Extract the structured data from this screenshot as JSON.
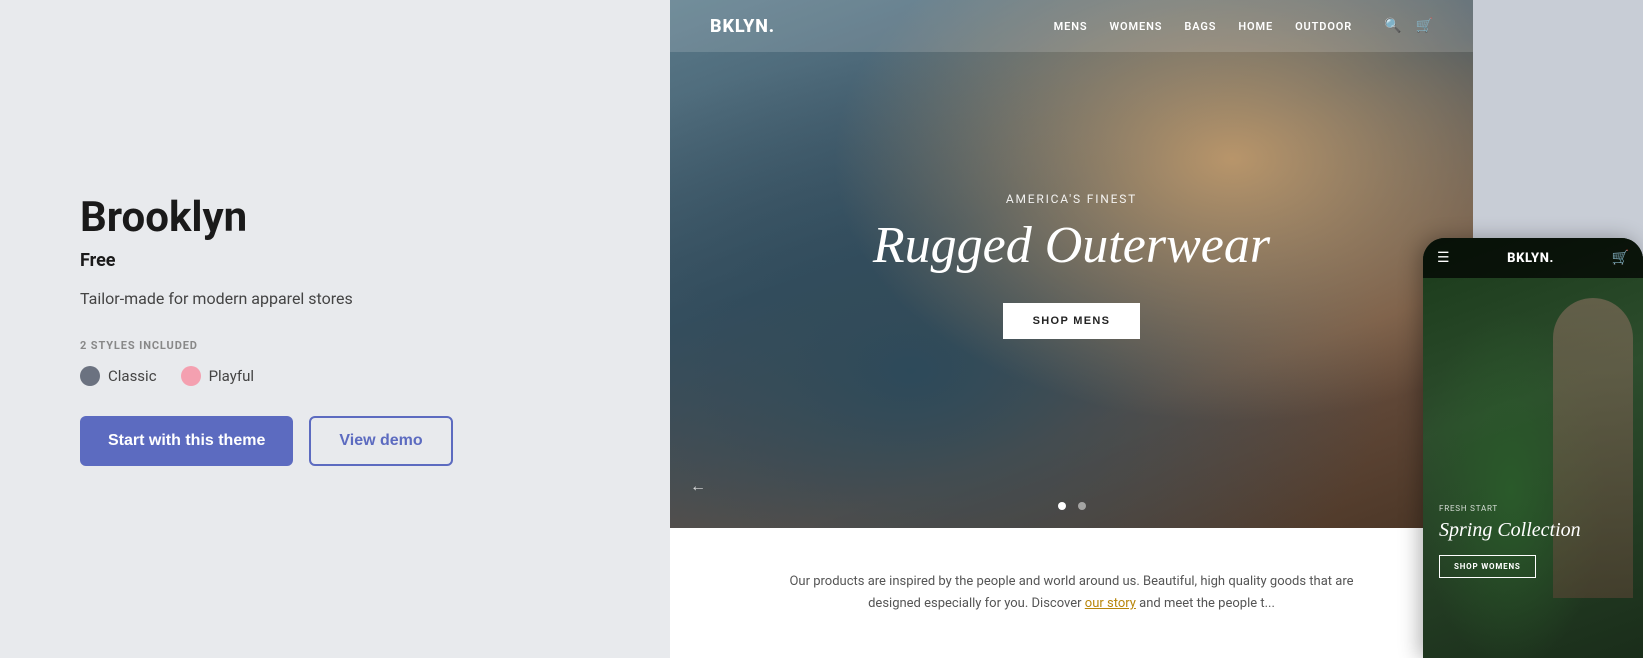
{
  "left": {
    "title": "Brooklyn",
    "price": "Free",
    "description": "Tailor-made for modern apparel stores",
    "styles_label": "2 STYLES INCLUDED",
    "styles": [
      {
        "name": "Classic",
        "type": "classic"
      },
      {
        "name": "Playful",
        "type": "playful"
      }
    ],
    "btn_primary": "Start with this theme",
    "btn_secondary": "View demo"
  },
  "preview": {
    "desktop": {
      "logo": "BKLYN.",
      "nav": [
        "MENS",
        "WOMENS",
        "BAGS",
        "HOME",
        "OUTDOOR"
      ],
      "hero_subtitle": "AMERICA'S FINEST",
      "hero_title": "Rugged Outerwear",
      "hero_btn": "SHOP MENS",
      "bottom_text": "Our products are inspired by the people and world around us. Beautiful, high quality goods that are designed especially for you. Discover",
      "bottom_link": "our story",
      "bottom_text2": "and meet the people t..."
    },
    "mobile": {
      "logo": "BKLYN.",
      "hero_subtitle": "FRESH START",
      "hero_title": "Spring Collection",
      "hero_btn": "SHOP WOMENS"
    }
  }
}
